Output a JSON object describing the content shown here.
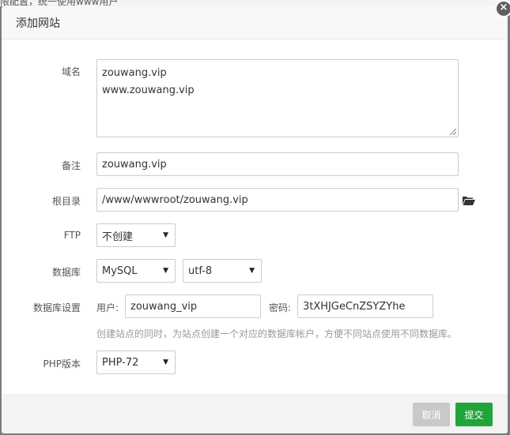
{
  "background": {
    "text": "限配置，统一使用www用户"
  },
  "dialog": {
    "title": "添加网站",
    "close_label": "×"
  },
  "form": {
    "domain": {
      "label": "域名",
      "lines": [
        "zouwang.vip",
        "www.zouwang.vip"
      ]
    },
    "remark": {
      "label": "备注",
      "value": "zouwang.vip"
    },
    "root": {
      "label": "根目录",
      "value": "/www/wwwroot/zouwang.vip",
      "icon": "folder-open-icon"
    },
    "ftp": {
      "label": "FTP",
      "value": "不创建"
    },
    "database": {
      "label": "数据库",
      "type": "MySQL",
      "charset": "utf-8"
    },
    "db_settings": {
      "label": "数据库设置",
      "user_label": "用户:",
      "user_value": "zouwang_vip",
      "password_label": "密码:",
      "password_value": "3tXHJGeCnZSYZYhe",
      "hint": "创建站点的同时，为站点创建一个对应的数据库帐户，方便不同站点使用不同数据库。"
    },
    "php": {
      "label": "PHP版本",
      "value": "PHP-72"
    }
  },
  "footer": {
    "cancel_label": "取消",
    "submit_label": "提交"
  },
  "colors": {
    "submit": "#20a53a",
    "cancel": "#c9c9c9"
  }
}
